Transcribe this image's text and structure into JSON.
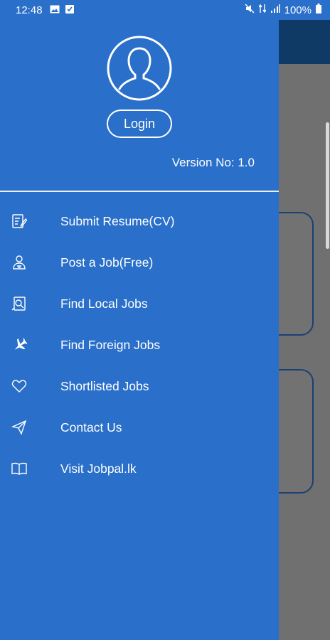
{
  "status_bar": {
    "time": "12:48",
    "battery": "100%"
  },
  "drawer": {
    "login_label": "Login",
    "version": "Version No: 1.0",
    "items": [
      {
        "label": "Submit Resume(CV)",
        "icon": "resume-icon"
      },
      {
        "label": "Post a Job(Free)",
        "icon": "person-post-icon"
      },
      {
        "label": "Find Local Jobs",
        "icon": "local-jobs-icon"
      },
      {
        "label": "Find Foreign Jobs",
        "icon": "airplane-icon"
      },
      {
        "label": "Shortlisted Jobs",
        "icon": "heart-icon"
      },
      {
        "label": "Contact Us",
        "icon": "send-icon"
      },
      {
        "label": "Visit Jobpal.lk",
        "icon": "book-icon"
      }
    ]
  },
  "colors": {
    "drawer": "#2a6fc9",
    "appbar": "#0f3a66",
    "overlay": "#707070"
  }
}
